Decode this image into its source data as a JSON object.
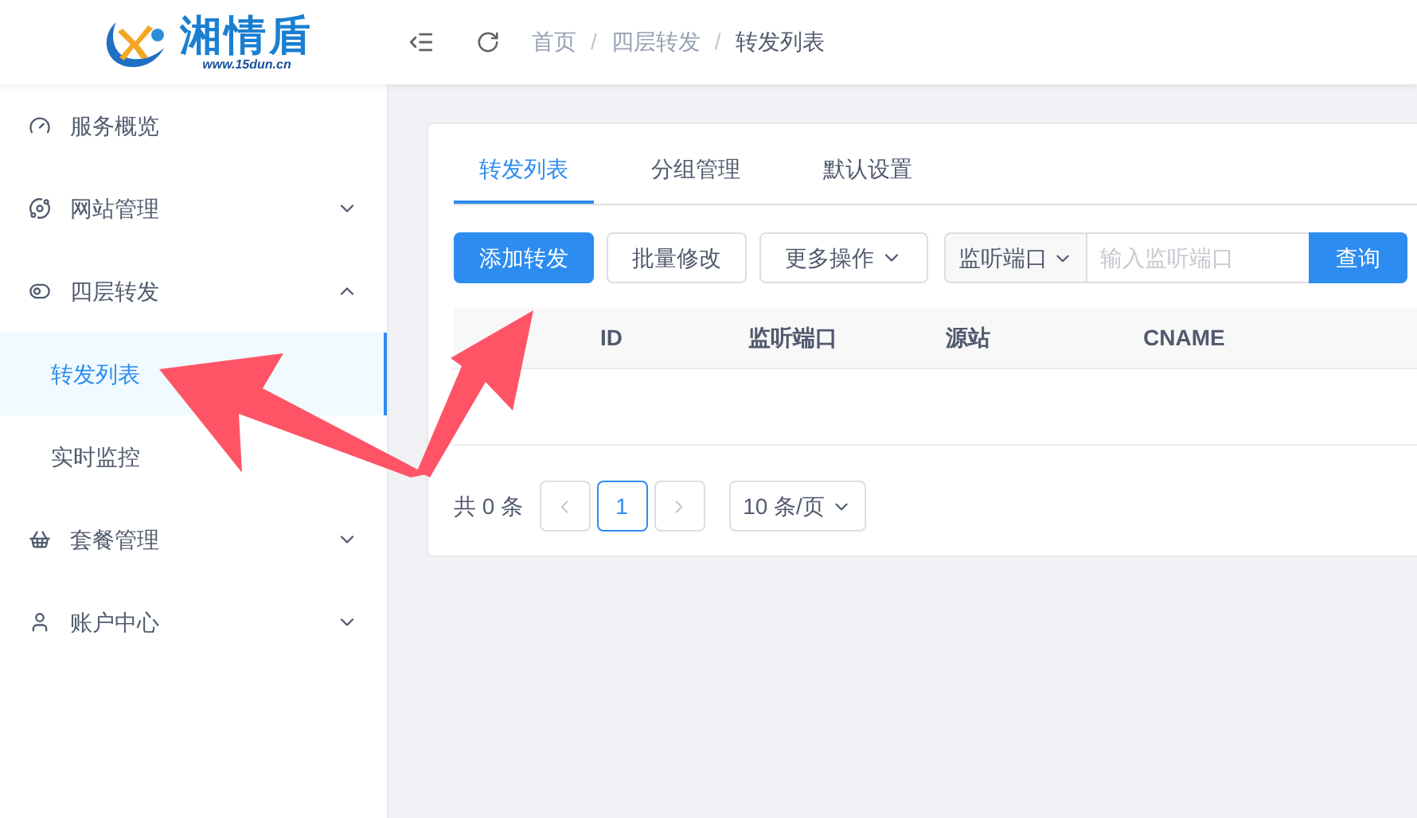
{
  "logo": {
    "name": "湘情盾",
    "url": "www.15dun.cn"
  },
  "breadcrumb": [
    "首页",
    "四层转发",
    "转发列表"
  ],
  "breadcrumb_separator": "/",
  "sidebar": {
    "items": [
      {
        "label": "服务概览",
        "selected": false
      },
      {
        "label": "网站管理",
        "expanded": false,
        "selected": false
      },
      {
        "label": "四层转发",
        "expanded": true,
        "selected": false,
        "children": [
          {
            "label": "转发列表",
            "selected": true
          },
          {
            "label": "实时监控",
            "selected": false
          }
        ]
      },
      {
        "label": "套餐管理",
        "expanded": false,
        "selected": false
      },
      {
        "label": "账户中心",
        "expanded": false,
        "selected": false
      }
    ]
  },
  "tabs": [
    {
      "label": "转发列表",
      "selected": true
    },
    {
      "label": "分组管理",
      "selected": false
    },
    {
      "label": "默认设置",
      "selected": false
    }
  ],
  "toolbar": {
    "buttons": [
      {
        "label": "添加转发",
        "kind": "primary"
      },
      {
        "label": "批量修改",
        "kind": "plain"
      },
      {
        "label": "更多操作",
        "kind": "dropdown"
      }
    ],
    "search": {
      "field_select": "监听端口",
      "placeholder": "输入监听端口",
      "button": "查询"
    }
  },
  "table": {
    "columns": [
      "ID",
      "监听端口",
      "源站",
      "CNAME"
    ]
  },
  "pagination": {
    "total": "共 0 条",
    "pages": [
      {
        "label": "1",
        "selected": true
      }
    ],
    "page_size": "10 条/页"
  }
}
